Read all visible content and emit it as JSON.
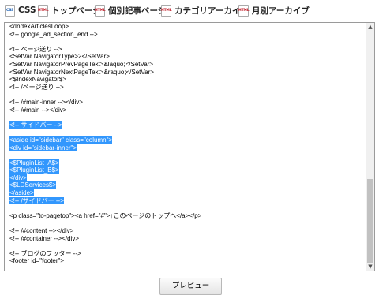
{
  "tabs": [
    {
      "label": "CSS",
      "icon": "css-file-icon",
      "icon_text": "CSS",
      "icon_color": "#1a5fb4"
    },
    {
      "label": "トップページ",
      "icon": "html-file-icon",
      "icon_text": "HTML",
      "icon_color": "#c01c28"
    },
    {
      "label": "個別記事ページ",
      "icon": "html-file-icon",
      "icon_text": "HTML",
      "icon_color": "#c01c28"
    },
    {
      "label": "カテゴリアーカイブ",
      "icon": "html-file-icon",
      "icon_text": "HTML",
      "icon_color": "#c01c28"
    },
    {
      "label": "月別アーカイブ",
      "icon": "html-file-icon",
      "icon_text": "HTML",
      "icon_color": "#c01c28"
    }
  ],
  "active_tab": "トップページ",
  "editor": {
    "lines": [
      {
        "text": "</IndexArticlesLoop>",
        "selected": false
      },
      {
        "text": "<!-- google_ad_section_end -->",
        "selected": false
      },
      {
        "text": "",
        "selected": false
      },
      {
        "text": "<!-- ページ送り -->",
        "selected": false
      },
      {
        "text": "<SetVar NavigatorType>2</SetVar>",
        "selected": false
      },
      {
        "text": "<SetVar NavigatorPrevPageText>&laquo;</SetVar>",
        "selected": false
      },
      {
        "text": "<SetVar NavigatorNextPageText>&raquo;</SetVar>",
        "selected": false
      },
      {
        "text": "<$IndexNavigator$>",
        "selected": false
      },
      {
        "text": "<!-- /ページ送り -->",
        "selected": false
      },
      {
        "text": "",
        "selected": false
      },
      {
        "text": "<!-- /#main-inner --></div>",
        "selected": false
      },
      {
        "text": "<!-- /#main --></div>",
        "selected": false
      },
      {
        "text": "",
        "selected": false
      },
      {
        "text": "<!-- サイドバー -->",
        "selected": true
      },
      {
        "text": "",
        "selected": false
      },
      {
        "text": "<aside id=\"sidebar\" class=\"column\">",
        "selected": true
      },
      {
        "text": "<div id=\"sidebar-inner\">",
        "selected": true
      },
      {
        "text": "",
        "selected": false
      },
      {
        "text": "<$PluginList_A$>",
        "selected": true
      },
      {
        "text": "<$PluginList_B$>",
        "selected": true
      },
      {
        "text": "</div>",
        "selected": true
      },
      {
        "text": "<$LDServices$>",
        "selected": true
      },
      {
        "text": "</aside>",
        "selected": true
      },
      {
        "text": "<!-- /サイドバー -->",
        "selected": true
      },
      {
        "text": "",
        "selected": false
      },
      {
        "text": "<p class=\"to-pagetop\"><a href=\"#\">↑このページのトップへ</a></p>",
        "selected": false
      },
      {
        "text": "",
        "selected": false
      },
      {
        "text": "<!-- /#content --></div>",
        "selected": false
      },
      {
        "text": "<!-- /#container --></div>",
        "selected": false
      },
      {
        "text": "",
        "selected": false
      },
      {
        "text": "<!-- ブログのフッター -->",
        "selected": false
      },
      {
        "text": "<footer id=\"footer\">",
        "selected": false
      }
    ]
  },
  "preview_button": "プレビュー",
  "colors": {
    "selection": "#3297fd"
  }
}
